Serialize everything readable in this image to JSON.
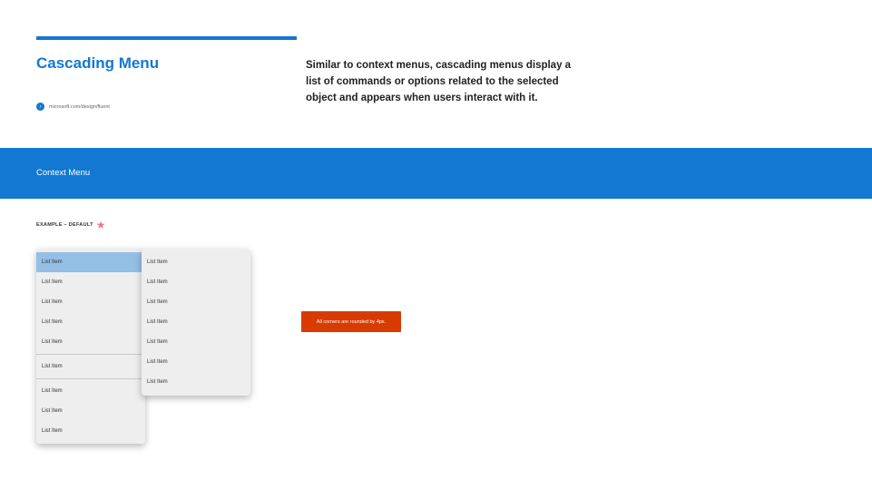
{
  "header": {
    "title": "Cascading Menu",
    "link_text": "microsoft.com/design/fluent",
    "link_icon": "arrow-circle-icon",
    "description": "Similar to context menus, cascading menus display a list of commands or options related to the selected object and appears when users interact with it."
  },
  "banner": {
    "title": "Context Menu"
  },
  "example": {
    "label": "EXAMPLE – DEFAULT",
    "marker_icon": "star-icon"
  },
  "primary_menu": {
    "items": [
      {
        "label": "List Item"
      },
      {
        "label": "List Item"
      },
      {
        "label": "List Item"
      },
      {
        "label": "List Item"
      },
      {
        "label": "List Item"
      },
      {
        "label": "List Item"
      },
      {
        "label": "List Item"
      },
      {
        "label": "List Item"
      },
      {
        "label": "List Item"
      }
    ]
  },
  "secondary_menu": {
    "items": [
      {
        "label": "List Item"
      },
      {
        "label": "List Item"
      },
      {
        "label": "List Item"
      },
      {
        "label": "List Item"
      },
      {
        "label": "List Item"
      },
      {
        "label": "List Item"
      },
      {
        "label": "List Item"
      }
    ]
  },
  "callout": {
    "text": "All corners are rounded by 4px."
  },
  "colors": {
    "accent": "#1378d1",
    "selected_item": "#94bfe6",
    "menu_background": "#eeeeee",
    "callout": "#d83b01",
    "star": "#e97b85"
  }
}
